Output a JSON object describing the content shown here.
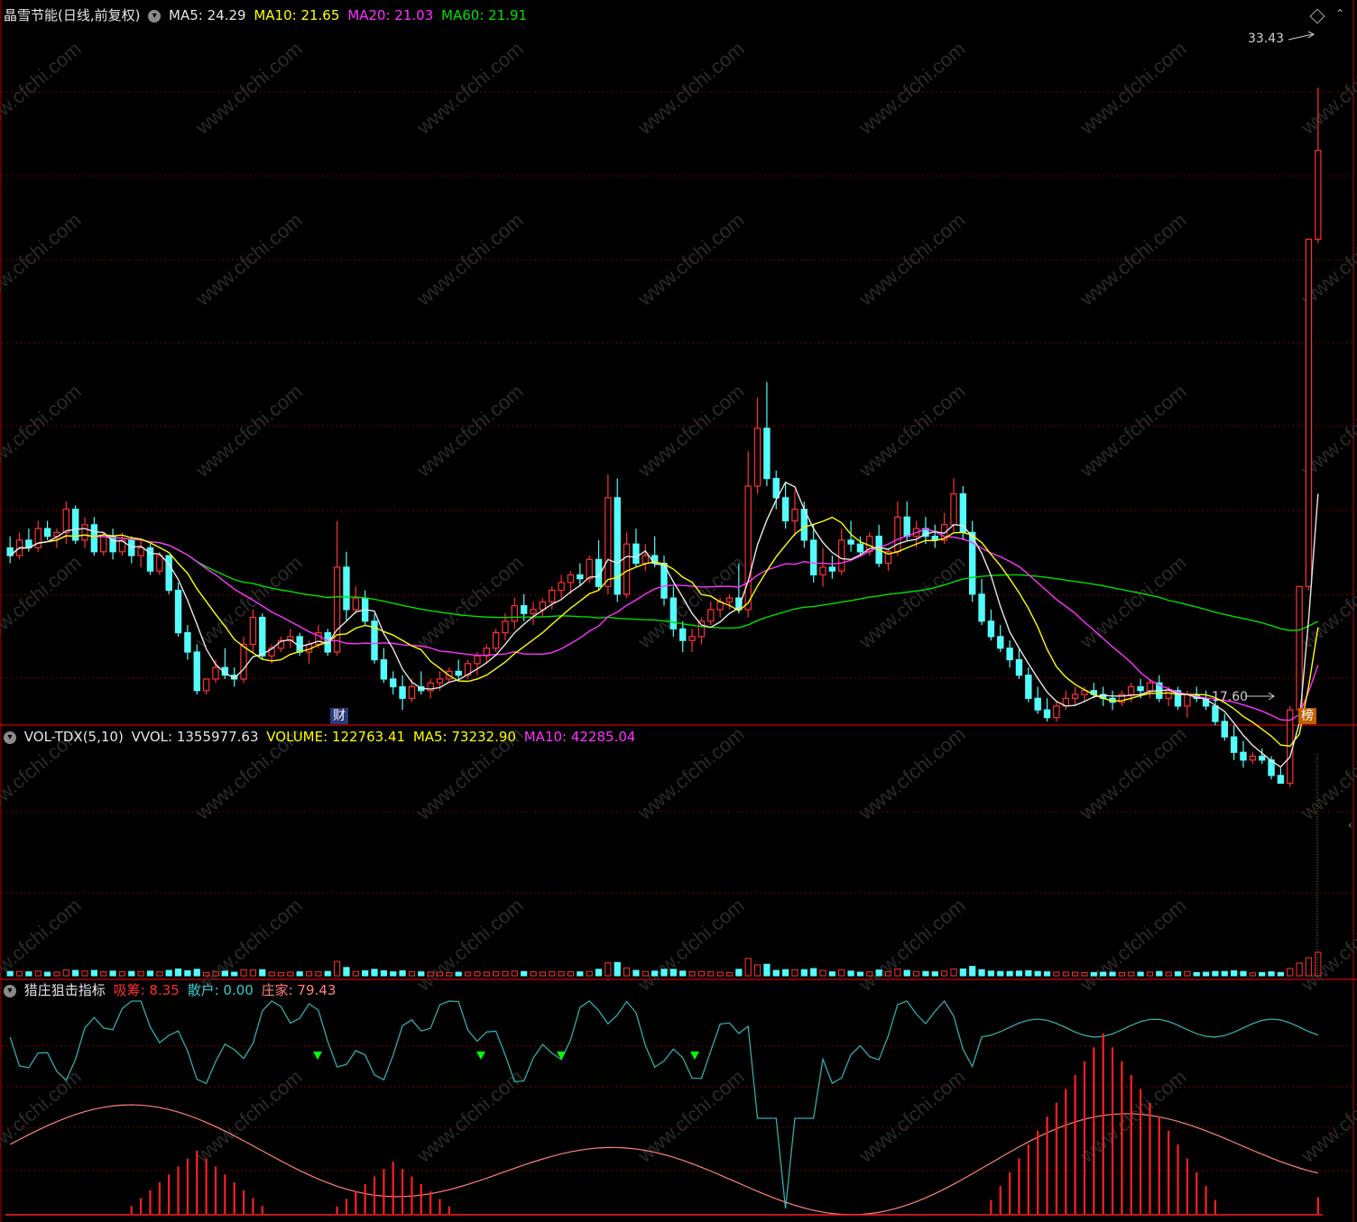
{
  "main_panel": {
    "title": "晶雪节能(日线,前复权)",
    "ma_labels": [
      {
        "text": "MA5: 24.29",
        "color": "#e6e6e6"
      },
      {
        "text": "MA10: 21.65",
        "color": "#ffff00"
      },
      {
        "text": "MA20: 21.03",
        "color": "#ff33ff"
      },
      {
        "text": "MA60: 21.91",
        "color": "#00e000"
      }
    ],
    "high_label": "33.43",
    "low_label": "17.60",
    "tag_finance": "财",
    "tag_list": "榜"
  },
  "volume_panel": {
    "title": "VOL-TDX(5,10)",
    "labels": [
      {
        "text": "VVOL: 1355977.63",
        "color": "#e6e6e6"
      },
      {
        "text": "VOLUME: 122763.41",
        "color": "#ffff00"
      },
      {
        "text": "MA5: 73232.90",
        "color": "#ffff00"
      },
      {
        "text": "MA10: 42285.04",
        "color": "#ff33ff"
      }
    ]
  },
  "indicator_panel": {
    "title": "猎庄狙击指标",
    "labels": [
      {
        "text": "吸筹: 8.35",
        "color": "#ff3030"
      },
      {
        "text": "散户: 0.00",
        "color": "#33cccc"
      },
      {
        "text": "庄家: 79.43",
        "color": "#ff8080"
      }
    ]
  },
  "watermark": "www.cfchi.com",
  "colors": {
    "up": "#ff3232",
    "down": "#54fcfc",
    "grid": "#7a0000",
    "border": "#b00000",
    "ma5": "#e6e6e6",
    "ma10": "#ffff00",
    "ma20": "#ff33ff",
    "ma60": "#00e000",
    "retail": "#33aaaa",
    "banker": "#ff8080",
    "accum": "#ff2020",
    "signal": "#00ff00"
  },
  "chart_data": {
    "type": "candlestick",
    "price_range": [
      17.0,
      35.0
    ],
    "candles": [
      [
        21.5,
        21.8,
        21.1,
        21.3
      ],
      [
        21.3,
        21.9,
        21.2,
        21.7
      ],
      [
        21.7,
        22.0,
        21.4,
        21.5
      ],
      [
        21.5,
        22.2,
        21.4,
        22.0
      ],
      [
        22.0,
        22.2,
        21.7,
        21.8
      ],
      [
        21.8,
        22.0,
        21.5,
        21.9
      ],
      [
        21.9,
        22.7,
        21.6,
        22.5
      ],
      [
        22.5,
        22.6,
        21.6,
        21.7
      ],
      [
        21.7,
        22.3,
        21.5,
        22.1
      ],
      [
        22.1,
        22.3,
        21.3,
        21.4
      ],
      [
        21.4,
        21.9,
        21.3,
        21.8
      ],
      [
        21.8,
        22.0,
        21.2,
        21.4
      ],
      [
        21.4,
        21.9,
        21.3,
        21.7
      ],
      [
        21.7,
        21.8,
        21.1,
        21.3
      ],
      [
        21.3,
        21.7,
        21.0,
        21.5
      ],
      [
        21.5,
        21.6,
        20.8,
        20.9
      ],
      [
        20.9,
        21.4,
        20.8,
        21.3
      ],
      [
        21.3,
        21.3,
        20.3,
        20.4
      ],
      [
        20.4,
        20.6,
        19.2,
        19.3
      ],
      [
        19.3,
        19.5,
        18.6,
        18.8
      ],
      [
        18.8,
        19.0,
        17.7,
        17.8
      ],
      [
        17.8,
        18.1,
        17.7,
        18.1
      ],
      [
        18.1,
        18.6,
        18.0,
        18.4
      ],
      [
        18.4,
        18.9,
        18.1,
        18.2
      ],
      [
        18.2,
        18.4,
        17.9,
        18.1
      ],
      [
        18.1,
        19.2,
        18.0,
        19.0
      ],
      [
        19.0,
        19.9,
        18.8,
        19.7
      ],
      [
        19.7,
        19.8,
        18.6,
        18.7
      ],
      [
        18.7,
        19.0,
        18.5,
        18.9
      ],
      [
        18.9,
        19.2,
        18.8,
        19.1
      ],
      [
        19.1,
        19.4,
        18.9,
        19.2
      ],
      [
        19.2,
        19.3,
        18.7,
        18.8
      ],
      [
        18.8,
        19.1,
        18.5,
        19.0
      ],
      [
        19.0,
        19.5,
        18.9,
        19.3
      ],
      [
        19.3,
        19.4,
        18.7,
        18.8
      ],
      [
        18.8,
        22.2,
        18.7,
        21.0
      ],
      [
        21.0,
        21.4,
        19.6,
        19.9
      ],
      [
        19.9,
        20.5,
        19.8,
        20.2
      ],
      [
        20.2,
        20.4,
        19.5,
        19.6
      ],
      [
        19.6,
        19.8,
        18.5,
        18.6
      ],
      [
        18.6,
        18.9,
        18.0,
        18.1
      ],
      [
        18.1,
        18.3,
        17.7,
        17.9
      ],
      [
        17.9,
        18.2,
        17.3,
        17.6
      ],
      [
        17.6,
        18.1,
        17.5,
        17.9
      ],
      [
        17.9,
        18.3,
        17.7,
        17.8
      ],
      [
        17.8,
        18.1,
        17.6,
        18.0
      ],
      [
        18.0,
        18.3,
        17.8,
        18.1
      ],
      [
        18.1,
        18.4,
        18.0,
        18.3
      ],
      [
        18.3,
        18.6,
        18.1,
        18.2
      ],
      [
        18.2,
        18.6,
        18.1,
        18.5
      ],
      [
        18.5,
        18.8,
        18.2,
        18.7
      ],
      [
        18.7,
        19.0,
        18.5,
        18.9
      ],
      [
        18.9,
        19.4,
        18.8,
        19.3
      ],
      [
        19.3,
        19.8,
        19.1,
        19.6
      ],
      [
        19.6,
        20.2,
        19.4,
        20.0
      ],
      [
        20.0,
        20.3,
        19.6,
        19.8
      ],
      [
        19.8,
        20.1,
        19.5,
        19.9
      ],
      [
        19.9,
        20.2,
        19.7,
        20.1
      ],
      [
        20.1,
        20.5,
        19.9,
        20.4
      ],
      [
        20.4,
        20.8,
        20.2,
        20.6
      ],
      [
        20.6,
        20.9,
        20.3,
        20.8
      ],
      [
        20.8,
        21.1,
        20.5,
        20.7
      ],
      [
        20.7,
        21.3,
        20.6,
        21.2
      ],
      [
        21.2,
        21.7,
        20.4,
        20.5
      ],
      [
        20.5,
        23.4,
        20.3,
        22.8
      ],
      [
        22.8,
        23.3,
        20.1,
        20.3
      ],
      [
        20.3,
        21.9,
        20.2,
        21.6
      ],
      [
        21.6,
        22.0,
        21.0,
        21.1
      ],
      [
        21.1,
        21.6,
        20.9,
        21.3
      ],
      [
        21.3,
        21.8,
        21.0,
        21.1
      ],
      [
        21.1,
        21.3,
        20.0,
        20.2
      ],
      [
        20.2,
        20.5,
        19.2,
        19.4
      ],
      [
        19.4,
        19.6,
        18.8,
        19.1
      ],
      [
        19.1,
        19.4,
        18.8,
        19.2
      ],
      [
        19.2,
        19.7,
        19.0,
        19.6
      ],
      [
        19.6,
        20.1,
        19.5,
        19.9
      ],
      [
        19.9,
        20.2,
        19.7,
        20.1
      ],
      [
        20.1,
        20.3,
        19.9,
        20.2
      ],
      [
        20.2,
        21.1,
        19.8,
        19.9
      ],
      [
        19.9,
        24.0,
        19.7,
        23.1
      ],
      [
        23.1,
        25.4,
        22.9,
        24.6
      ],
      [
        24.6,
        25.8,
        23.1,
        23.3
      ],
      [
        23.3,
        23.5,
        22.5,
        22.8
      ],
      [
        22.8,
        23.2,
        22.0,
        22.2
      ],
      [
        22.2,
        23.0,
        21.8,
        22.5
      ],
      [
        22.5,
        22.7,
        21.5,
        21.7
      ],
      [
        21.7,
        22.1,
        20.6,
        20.8
      ],
      [
        20.8,
        21.5,
        20.5,
        21.0
      ],
      [
        21.0,
        21.3,
        20.7,
        20.9
      ],
      [
        20.9,
        22.0,
        20.8,
        21.7
      ],
      [
        21.7,
        22.2,
        21.4,
        21.6
      ],
      [
        21.6,
        21.8,
        21.3,
        21.4
      ],
      [
        21.4,
        21.9,
        21.3,
        21.8
      ],
      [
        21.8,
        22.1,
        21.0,
        21.1
      ],
      [
        21.1,
        21.5,
        20.9,
        21.4
      ],
      [
        21.4,
        22.7,
        21.3,
        22.3
      ],
      [
        22.3,
        22.7,
        21.7,
        21.8
      ],
      [
        21.8,
        22.2,
        21.5,
        22.0
      ],
      [
        22.0,
        22.3,
        21.6,
        21.8
      ],
      [
        21.8,
        22.1,
        21.5,
        21.7
      ],
      [
        21.7,
        22.4,
        21.6,
        22.1
      ],
      [
        22.1,
        23.3,
        21.9,
        22.9
      ],
      [
        22.9,
        23.1,
        21.7,
        21.9
      ],
      [
        21.9,
        22.2,
        20.1,
        20.3
      ],
      [
        20.3,
        20.7,
        19.5,
        19.6
      ],
      [
        19.6,
        19.9,
        19.1,
        19.2
      ],
      [
        19.2,
        19.5,
        18.8,
        18.9
      ],
      [
        18.9,
        19.1,
        18.4,
        18.6
      ],
      [
        18.6,
        18.9,
        18.1,
        18.2
      ],
      [
        18.2,
        18.4,
        17.5,
        17.6
      ],
      [
        17.6,
        17.9,
        17.2,
        17.3
      ],
      [
        17.3,
        17.6,
        17.0,
        17.1
      ],
      [
        17.1,
        17.5,
        17.0,
        17.4
      ],
      [
        17.4,
        17.8,
        17.3,
        17.6
      ],
      [
        17.6,
        17.9,
        17.4,
        17.7
      ],
      [
        17.7,
        17.9,
        17.5,
        17.8
      ],
      [
        17.8,
        18.0,
        17.6,
        17.7
      ],
      [
        17.7,
        17.9,
        17.4,
        17.6
      ],
      [
        17.6,
        17.8,
        17.3,
        17.5
      ],
      [
        17.5,
        17.8,
        17.4,
        17.7
      ],
      [
        17.7,
        18.0,
        17.5,
        17.9
      ],
      [
        17.9,
        18.1,
        17.6,
        17.8
      ],
      [
        17.8,
        18.1,
        17.6,
        18.0
      ],
      [
        18.0,
        18.2,
        17.5,
        17.6
      ],
      [
        17.6,
        17.9,
        17.4,
        17.8
      ],
      [
        17.8,
        17.9,
        17.3,
        17.4
      ],
      [
        17.4,
        17.8,
        17.1,
        17.7
      ],
      [
        17.7,
        17.9,
        17.5,
        17.6
      ],
      [
        17.6,
        17.8,
        17.3,
        17.4
      ],
      [
        17.4,
        17.6,
        16.9,
        17.0
      ],
      [
        17.0,
        17.2,
        16.5,
        16.6
      ],
      [
        16.6,
        16.9,
        16.0,
        16.2
      ],
      [
        16.2,
        16.5,
        15.8,
        16.0
      ],
      [
        16.0,
        16.2,
        15.9,
        16.1
      ],
      [
        16.1,
        16.3,
        15.9,
        16.0
      ],
      [
        16.0,
        16.1,
        15.5,
        15.6
      ],
      [
        15.6,
        15.8,
        15.4,
        15.4
      ],
      [
        15.4,
        17.4,
        15.3,
        17.3
      ],
      [
        17.3,
        20.5,
        17.2,
        20.5
      ],
      [
        20.5,
        29.5,
        20.4,
        29.5
      ],
      [
        29.5,
        33.43,
        29.4,
        31.8
      ]
    ]
  }
}
